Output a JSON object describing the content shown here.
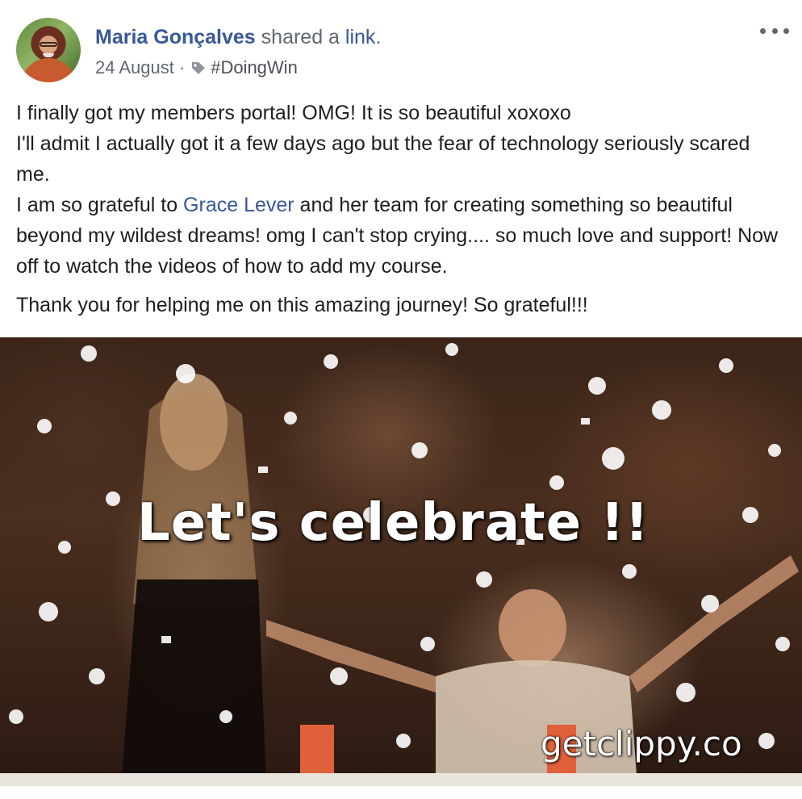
{
  "post": {
    "author": "Maria Gonçalves",
    "verb": "shared a",
    "link_text": "link",
    "end_punct": ".",
    "date": "24 August",
    "separator": "·",
    "hashtag": "#DoingWin",
    "more_icon": "more-horizontal-icon",
    "tag_icon": "tag-icon",
    "body": {
      "line1": "I finally got my members portal! OMG! It is so beautiful xoxoxo",
      "line2": "I'll admit I actually got it a few days ago but the fear of technology seriously scared me.",
      "line3_before": "I am so grateful to ",
      "mention": "Grace Lever",
      "line3_after": " and her team for creating something so beautiful beyond my wildest dreams! omg I can't stop crying.... so much love and support! Now off to watch the videos of how to add my course.",
      "line4": "Thank you for helping me on this amazing journey! So grateful!!!"
    },
    "gif": {
      "caption": "Let's celebrate !!",
      "watermark": "getclippy.co"
    }
  },
  "colors": {
    "link": "#385898",
    "meta": "#606770",
    "text": "#1c1e21"
  }
}
